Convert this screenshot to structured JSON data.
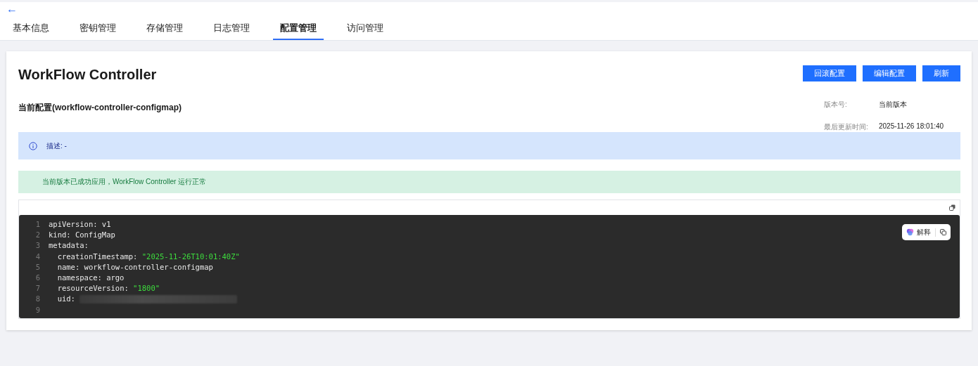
{
  "header": {
    "back": "←"
  },
  "tabs": [
    {
      "label": "基本信息",
      "selected": false
    },
    {
      "label": "密钥管理",
      "selected": false
    },
    {
      "label": "存储管理",
      "selected": false
    },
    {
      "label": "日志管理",
      "selected": false
    },
    {
      "label": "配置管理",
      "selected": true
    },
    {
      "label": "访问管理",
      "selected": false
    }
  ],
  "card": {
    "title": "WorkFlow Controller",
    "buttons": [
      "回滚配置",
      "编辑配置",
      "刷新"
    ],
    "section_title": "当前配置(workflow-controller-configmap)",
    "meta": [
      {
        "label": "版本号:",
        "value": "当前版本"
      },
      {
        "label": "最后更新时间:",
        "value": "2025-11-26 18:01:40"
      }
    ],
    "info_alert": "描述: -",
    "success_alert": "当前版本已成功应用，WorkFlow Controller 运行正常",
    "editor": {
      "explain_button": "解释",
      "lines": [
        {
          "number": "1",
          "key": "apiVersion:",
          "value": "v1",
          "kind": "plain"
        },
        {
          "number": "2",
          "key": "kind:",
          "value": "ConfigMap",
          "kind": "plain"
        },
        {
          "number": "3",
          "key": "metadata:"
        },
        {
          "number": "4",
          "key": "  creationTimestamp:",
          "value": "\"2025-11-26T10:01:40Z\"",
          "kind": "string"
        },
        {
          "number": "5",
          "key": "  name:",
          "value": "workflow-controller-configmap",
          "kind": "plain"
        },
        {
          "number": "6",
          "key": "  namespace:",
          "value": "argo",
          "kind": "plain"
        },
        {
          "number": "7",
          "key": "  resourceVersion:",
          "value": "\"1800\"",
          "kind": "string"
        },
        {
          "number": "8",
          "key": "  uid:",
          "kind": "redacted"
        },
        {
          "number": "9"
        }
      ]
    }
  }
}
